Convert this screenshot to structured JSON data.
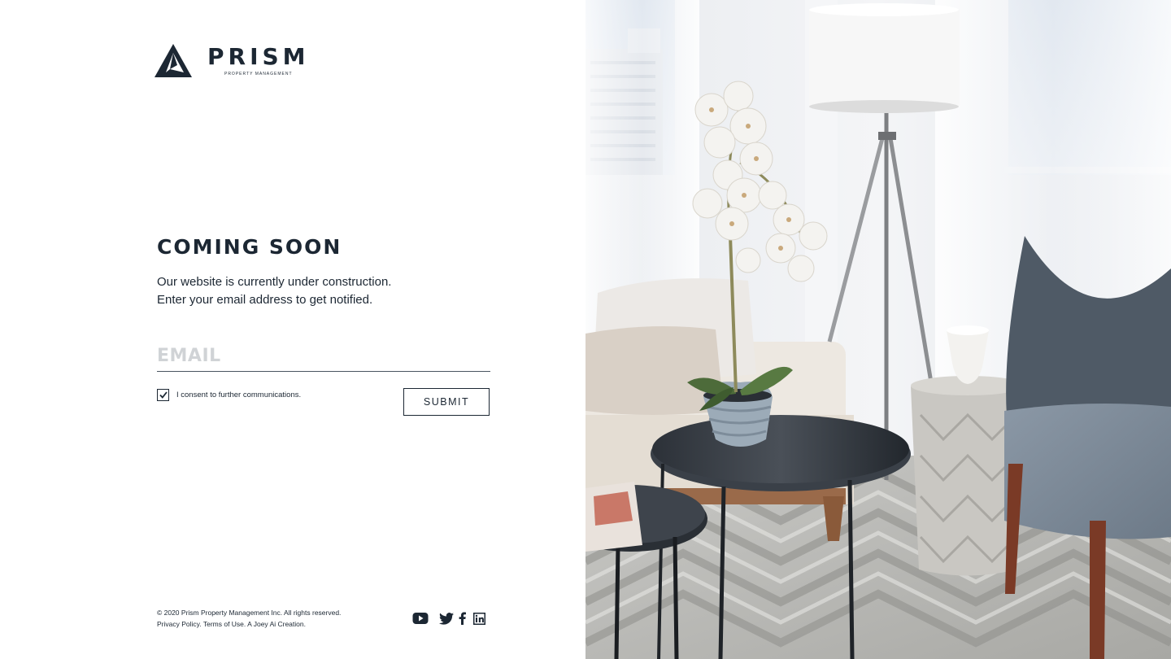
{
  "brand": {
    "name": "PRISM",
    "tagline": "PROPERTY MANAGEMENT",
    "color": "#1c2733"
  },
  "main": {
    "heading": "COMING SOON",
    "line1": "Our website is currently under construction.",
    "line2": "Enter your email address to get notified."
  },
  "form": {
    "email_placeholder": "EMAIL",
    "email_value": "",
    "consent_label": "I consent to further communications.",
    "consent_checked": true,
    "submit_label": "SUBMIT"
  },
  "footer": {
    "copyright": "© 2020 Prism Property Management Inc. All rights reserved.",
    "links": "Privacy Policy. Terms of Use. A Joey Ai Creation."
  },
  "social": [
    "youtube-icon",
    "twitter-icon",
    "facebook-icon",
    "linkedin-icon"
  ],
  "hero_image": "living room interior with white orchid, tripod floor lamp, round side tables, grey armchair"
}
